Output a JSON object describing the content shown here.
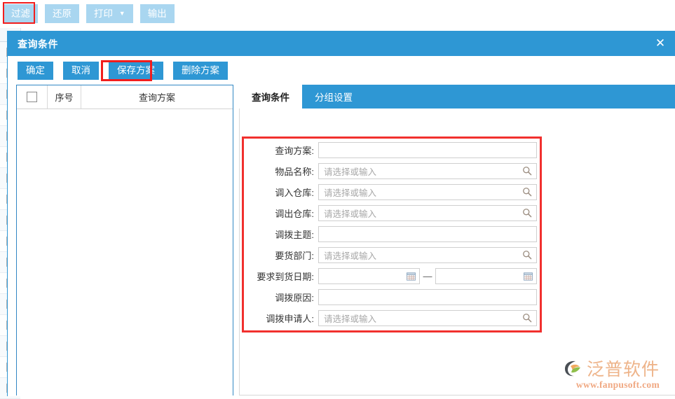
{
  "app": {
    "toolbar": {
      "buttons": [
        {
          "label": "过滤",
          "name": "filter-button",
          "highlighted": true
        },
        {
          "label": "还原",
          "name": "restore-button",
          "highlighted": false
        },
        {
          "label": "打印",
          "name": "print-button",
          "highlighted": false,
          "caret": "▼"
        },
        {
          "label": "输出",
          "name": "export-button",
          "highlighted": false
        }
      ]
    }
  },
  "dialog": {
    "title": "查询条件",
    "close_icon": "✕",
    "toolbar": {
      "confirm": "确定",
      "cancel": "取消",
      "save_plan": "保存方案",
      "delete_plan": "删除方案"
    },
    "plan_list": {
      "columns": [
        "",
        "序号",
        "查询方案"
      ],
      "rows": []
    },
    "tabs": [
      {
        "label": "查询条件",
        "active": true
      },
      {
        "label": "分组设置",
        "active": false
      }
    ],
    "form": {
      "placeholder": "请选择或输入",
      "date_separator": "—",
      "fields": [
        {
          "label": "查询方案:",
          "type": "text",
          "value": "",
          "placeholder": ""
        },
        {
          "label": "物品名称:",
          "type": "lookup",
          "value": "",
          "placeholder": "请选择或输入"
        },
        {
          "label": "调入仓库:",
          "type": "lookup",
          "value": "",
          "placeholder": "请选择或输入"
        },
        {
          "label": "调出仓库:",
          "type": "lookup",
          "value": "",
          "placeholder": "请选择或输入"
        },
        {
          "label": "调拨主题:",
          "type": "text",
          "value": "",
          "placeholder": ""
        },
        {
          "label": "要货部门:",
          "type": "lookup",
          "value": "",
          "placeholder": "请选择或输入"
        },
        {
          "label": "要求到货日期:",
          "type": "daterange",
          "value_from": "",
          "value_to": "",
          "placeholder": ""
        },
        {
          "label": "调拨原因:",
          "type": "text",
          "value": "",
          "placeholder": ""
        },
        {
          "label": "调拨申请人:",
          "type": "lookup",
          "value": "",
          "placeholder": "请选择或输入"
        }
      ]
    }
  },
  "watermark": {
    "brand": "泛普软件",
    "url": "www.fanpusoft.com"
  },
  "colors": {
    "header_blue": "#2e97d4",
    "toolbar_button_blue": "#a9d6f0",
    "highlight_red": "#f11d1d",
    "watermark_orange": "#eeb48a"
  }
}
